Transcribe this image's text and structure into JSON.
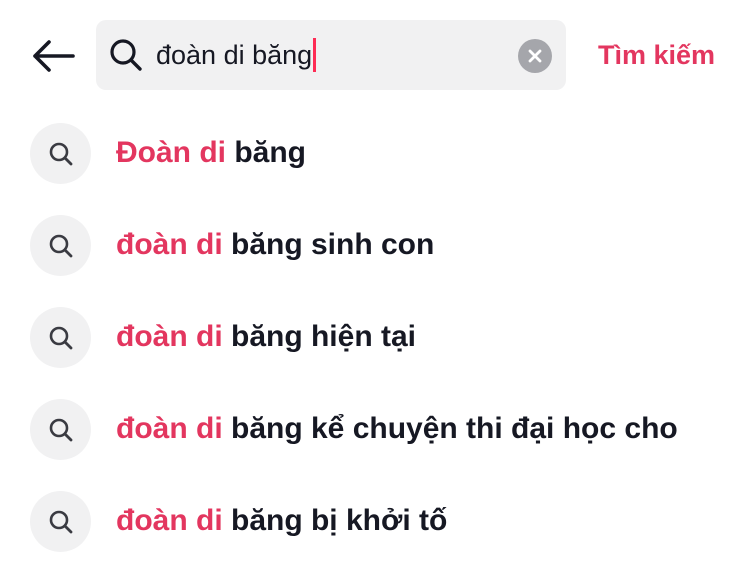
{
  "header": {
    "back_icon": "arrow-left-icon",
    "search": {
      "search_icon": "search-icon",
      "value": "đoàn di băng",
      "clear_icon": "clear-circle-icon"
    },
    "search_action_label": "Tìm kiếm"
  },
  "suggestions": [
    {
      "icon": "search-icon",
      "highlight": "Đoàn di",
      "rest": " băng"
    },
    {
      "icon": "search-icon",
      "highlight": "đoàn di",
      "rest": " băng sinh con"
    },
    {
      "icon": "search-icon",
      "highlight": "đoàn di",
      "rest": " băng hiện tại"
    },
    {
      "icon": "search-icon",
      "highlight": "đoàn di",
      "rest": " băng kể chuyện thi đại học cho"
    },
    {
      "icon": "search-icon",
      "highlight": "đoàn di",
      "rest": " băng bị khởi tố"
    }
  ],
  "colors": {
    "accent": "#e3365f",
    "text": "#161823",
    "field_bg": "#f1f1f2",
    "clear_bg": "#a5a6ab"
  }
}
